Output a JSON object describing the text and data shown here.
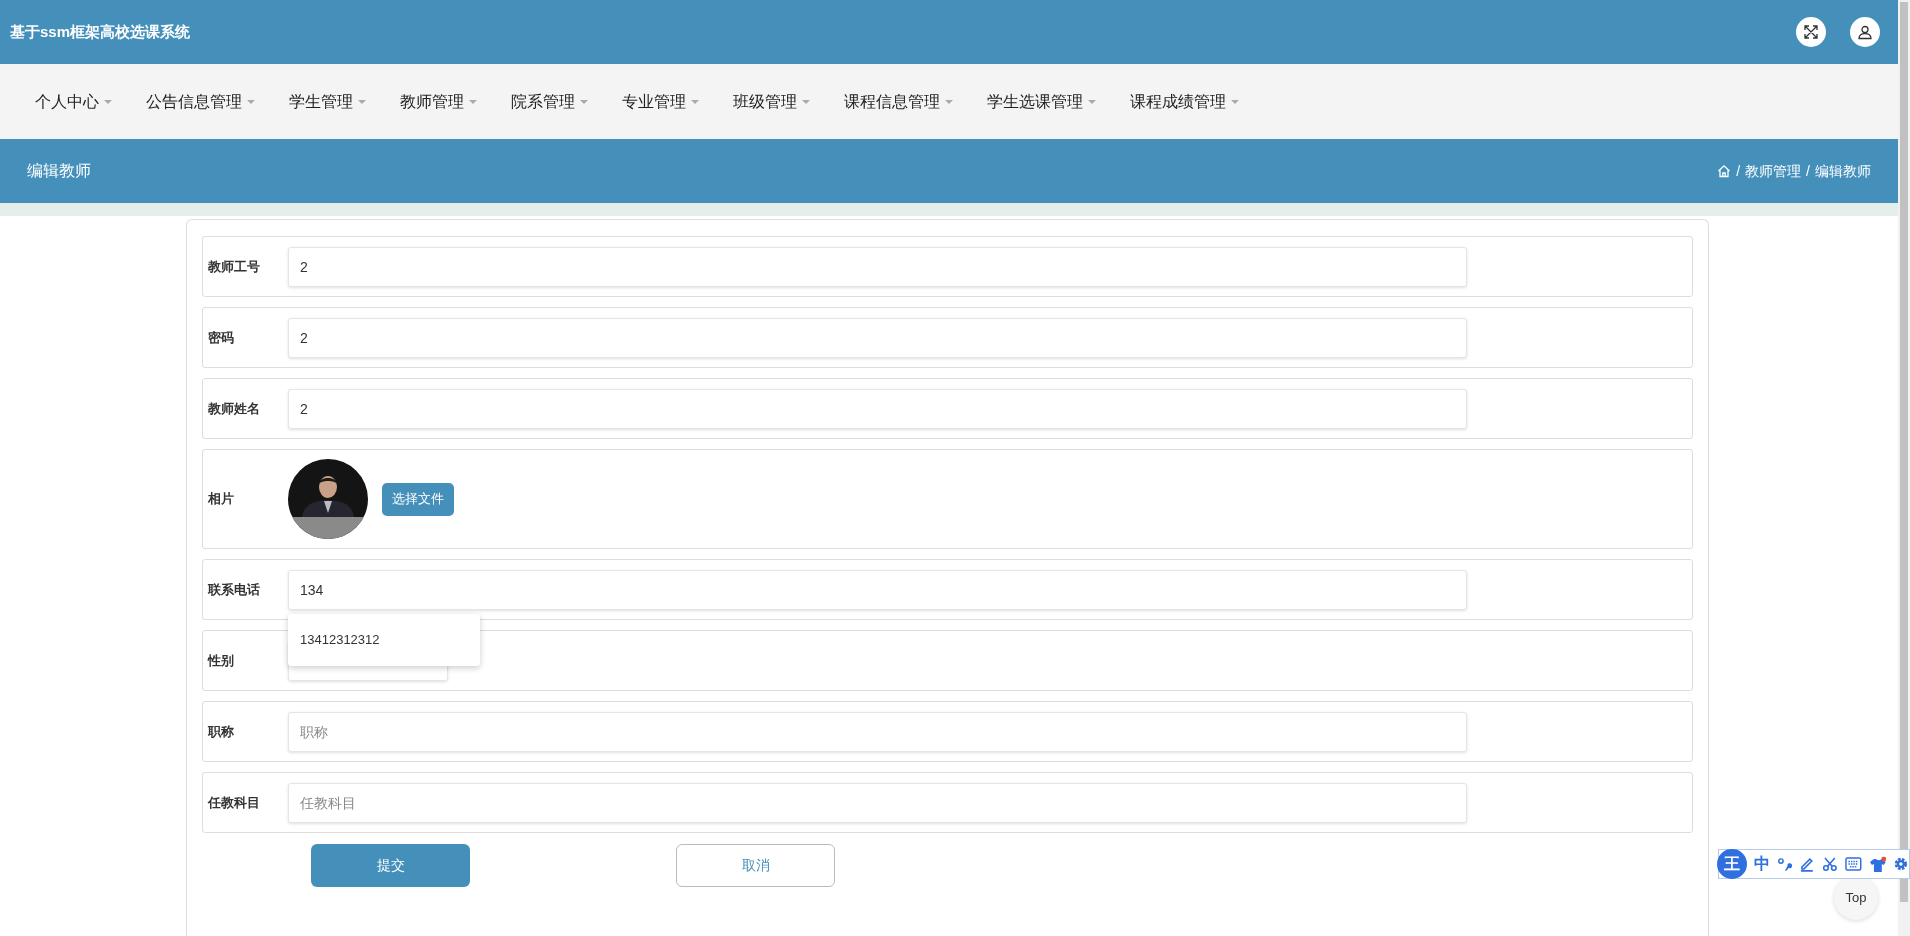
{
  "header": {
    "title": "基于ssm框架高校选课系统"
  },
  "nav": {
    "items": [
      {
        "label": "个人中心"
      },
      {
        "label": "公告信息管理"
      },
      {
        "label": "学生管理"
      },
      {
        "label": "教师管理"
      },
      {
        "label": "院系管理"
      },
      {
        "label": "专业管理"
      },
      {
        "label": "班级管理"
      },
      {
        "label": "课程信息管理"
      },
      {
        "label": "学生选课管理"
      },
      {
        "label": "课程成绩管理"
      }
    ]
  },
  "page_title": "编辑教师",
  "breadcrumb": {
    "separator": "/",
    "items": [
      {
        "label": "教师管理"
      },
      {
        "label": "编辑教师"
      }
    ]
  },
  "form": {
    "fields": [
      {
        "kind": "input",
        "label": "教师工号",
        "value": "2"
      },
      {
        "kind": "input",
        "label": "密码",
        "value": "2"
      },
      {
        "kind": "input",
        "label": "教师姓名",
        "value": "2"
      },
      {
        "label": "相片",
        "button": "选择文件"
      },
      {
        "kind": "input",
        "label": "联系电话",
        "value": "134",
        "suggestions": [
          "13412312312"
        ]
      },
      {
        "kind": "select",
        "label": "性别"
      },
      {
        "kind": "input",
        "label": "职称",
        "placeholder": "职称"
      },
      {
        "kind": "input",
        "label": "任教科目",
        "placeholder": "任教科目"
      }
    ],
    "submit": "提交",
    "cancel": "取消"
  },
  "ime_toolbar": {
    "logo": "王",
    "mode": "中"
  },
  "back_to_top": "Top"
}
